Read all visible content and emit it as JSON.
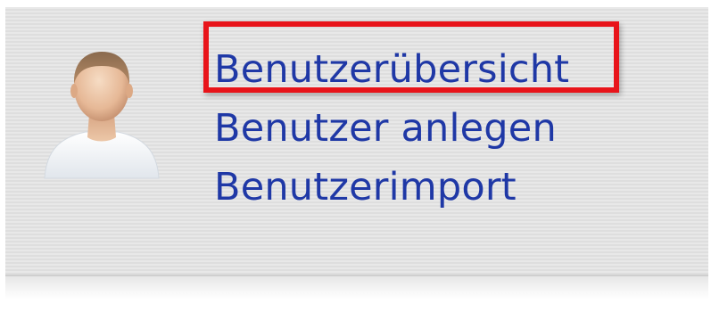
{
  "menu": {
    "items": [
      {
        "label": "Benutzerübersicht",
        "highlighted": true
      },
      {
        "label": "Benutzer anlegen",
        "highlighted": false
      },
      {
        "label": "Benutzerimport",
        "highlighted": false
      }
    ]
  },
  "icons": {
    "avatar": "user-avatar-icon"
  },
  "colors": {
    "link": "#1f38a6",
    "highlight_border": "#e8141a",
    "panel_background": "#e4e4e4"
  }
}
